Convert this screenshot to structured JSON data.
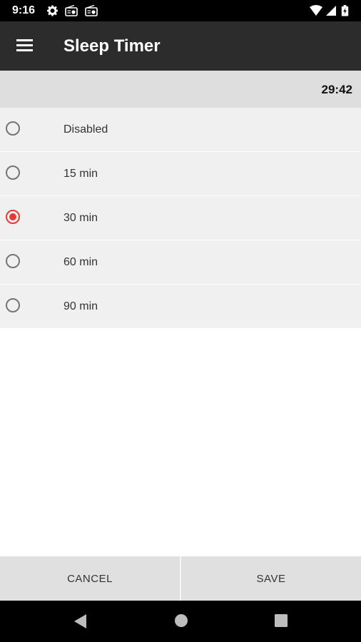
{
  "status_bar": {
    "time": "9:16",
    "icons": [
      "gear-icon",
      "radio-icon",
      "radio-icon",
      "wifi-icon",
      "signal-icon",
      "battery-icon"
    ]
  },
  "app_bar": {
    "title": "Sleep Timer",
    "menu_icon": "hamburger-menu-icon"
  },
  "timer": {
    "remaining": "29:42"
  },
  "options": [
    {
      "label": "Disabled",
      "selected": false
    },
    {
      "label": "15 min",
      "selected": false
    },
    {
      "label": "30 min",
      "selected": true
    },
    {
      "label": "60 min",
      "selected": false
    },
    {
      "label": "90 min",
      "selected": false
    }
  ],
  "buttons": {
    "cancel": "CANCEL",
    "save": "SAVE"
  },
  "nav": {
    "back": "back-triangle-icon",
    "home": "home-circle-icon",
    "recents": "recents-square-icon"
  },
  "colors": {
    "accent": "#e53935",
    "app_bar": "#2c2c2c",
    "option_bg": "#f0f0f0"
  }
}
